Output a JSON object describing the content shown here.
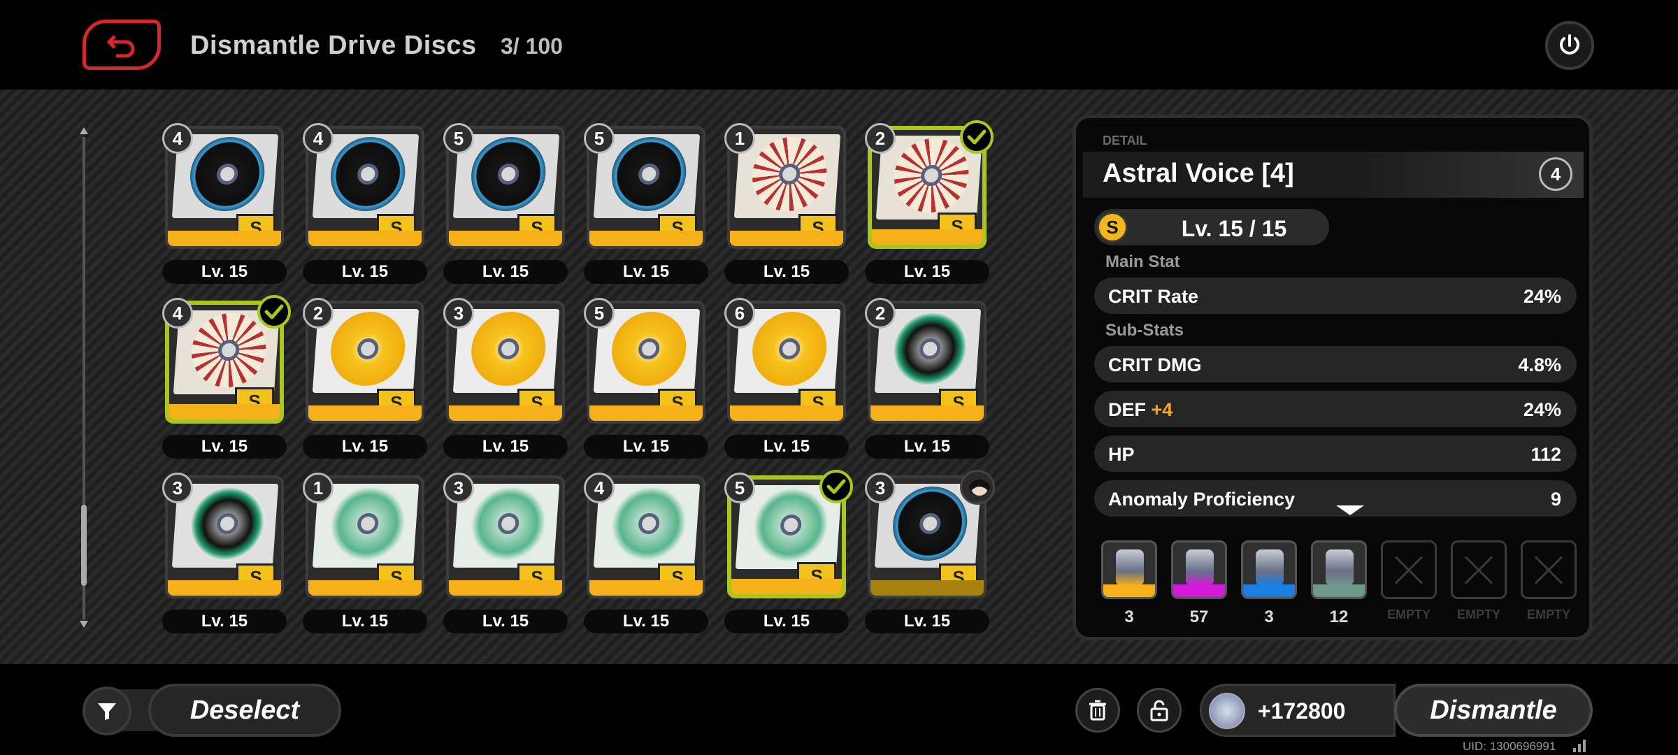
{
  "header": {
    "title": "Dismantle Drive Discs",
    "count": "3/ 100"
  },
  "discs": [
    {
      "slot": "4",
      "level": "Lv. 15",
      "art": "black-wolf",
      "selected": false
    },
    {
      "slot": "4",
      "level": "Lv. 15",
      "art": "black-wolf",
      "selected": false
    },
    {
      "slot": "5",
      "level": "Lv. 15",
      "art": "black-wolf",
      "selected": false
    },
    {
      "slot": "5",
      "level": "Lv. 15",
      "art": "black-wolf",
      "selected": false
    },
    {
      "slot": "1",
      "level": "Lv. 15",
      "art": "cream-red",
      "selected": false
    },
    {
      "slot": "2",
      "level": "Lv. 15",
      "art": "cream-red",
      "selected": true
    },
    {
      "slot": "4",
      "level": "Lv. 15",
      "art": "cream-red",
      "selected": true
    },
    {
      "slot": "2",
      "level": "Lv. 15",
      "art": "yellow-flame",
      "selected": false
    },
    {
      "slot": "3",
      "level": "Lv. 15",
      "art": "yellow-flame",
      "selected": false
    },
    {
      "slot": "5",
      "level": "Lv. 15",
      "art": "yellow-flame",
      "selected": false
    },
    {
      "slot": "6",
      "level": "Lv. 15",
      "art": "yellow-flame",
      "selected": false
    },
    {
      "slot": "2",
      "level": "Lv. 15",
      "art": "green-oxo",
      "selected": false
    },
    {
      "slot": "3",
      "level": "Lv. 15",
      "art": "green-oxo",
      "selected": false
    },
    {
      "slot": "1",
      "level": "Lv. 15",
      "art": "green-mint",
      "selected": false
    },
    {
      "slot": "3",
      "level": "Lv. 15",
      "art": "green-mint",
      "selected": false
    },
    {
      "slot": "4",
      "level": "Lv. 15",
      "art": "green-mint",
      "selected": false
    },
    {
      "slot": "5",
      "level": "Lv. 15",
      "art": "green-mint",
      "selected": true
    },
    {
      "slot": "3",
      "level": "Lv. 15",
      "art": "black-wolf",
      "selected": false,
      "equipped": true
    }
  ],
  "rarity_letter": "S",
  "detail": {
    "label": "DETAIL",
    "name": "Astral Voice [4]",
    "slot": "4",
    "rank_letter": "S",
    "level": "Lv. 15 / 15",
    "main_stat_label": "Main Stat",
    "main_stat": {
      "name": "CRIT Rate",
      "value": "24%"
    },
    "sub_stats_label": "Sub-Stats",
    "sub_stats": [
      {
        "name": "CRIT DMG",
        "plus": "",
        "value": "4.8%"
      },
      {
        "name": "DEF",
        "plus": "+4",
        "value": "24%"
      },
      {
        "name": "HP",
        "plus": "",
        "value": "112"
      },
      {
        "name": "Anomaly Proficiency",
        "plus": "",
        "value": "9"
      }
    ]
  },
  "materials": [
    {
      "count": "3",
      "color": "#f5b01a"
    },
    {
      "count": "57",
      "color": "#d21ad8"
    },
    {
      "count": "3",
      "color": "#1a7fe0"
    },
    {
      "count": "12",
      "color": "#6e9a8e"
    },
    {
      "count": "EMPTY",
      "empty": true
    },
    {
      "count": "EMPTY",
      "empty": true
    },
    {
      "count": "EMPTY",
      "empty": true
    }
  ],
  "footer": {
    "deselect_label": "Deselect",
    "reward_value": "+172800",
    "dismantle_label": "Dismantle",
    "uid": "UID: 1300696991"
  },
  "colors": {
    "accent_selected": "#a8c81e",
    "rarity_bar": "#f5b01a",
    "back_red": "#d4282b"
  }
}
